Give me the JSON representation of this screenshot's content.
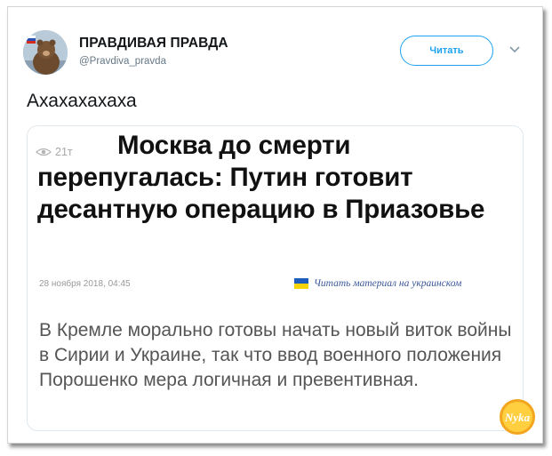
{
  "author": {
    "display_name": "ПРАВДИВАЯ ПРАВДА",
    "handle": "@Pravdiva_pravda"
  },
  "follow_label": "Читать",
  "tweet_text": "Ахахахахаха",
  "card": {
    "views": "21т",
    "headline": "Москва до смерти перепугалась: Путин готовит десантную операцию в Приазовье",
    "date": "28 ноября 2018, 04:45",
    "translate_link": "Читать материал на украинском",
    "body": "В Кремле морально готовы начать новый виток войны в Сирии и Украине, так что ввод военного положения Порошенко мера логичная и превентивная."
  },
  "watermark_text": "Nyka",
  "icons": {
    "avatar": "bear-avatar",
    "chevron": "chevron-down-icon",
    "views": "eye-icon",
    "flag": "ukraine-flag-icon",
    "watermark": "nyka-logo"
  },
  "colors": {
    "accent": "#1da1f2",
    "link": "#3b5998",
    "flag_blue": "#1e5bbf",
    "flag_yellow": "#f5d40b"
  }
}
